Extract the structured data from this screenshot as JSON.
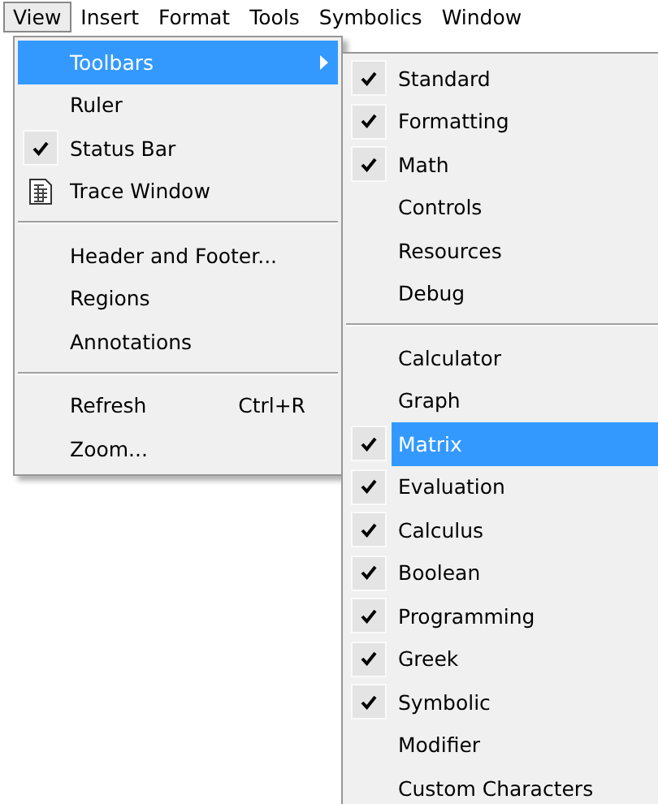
{
  "menu_bar": [
    {
      "label": "View",
      "selected": true
    },
    {
      "label": "Insert",
      "selected": false
    },
    {
      "label": "Format",
      "selected": false
    },
    {
      "label": "Tools",
      "selected": false
    },
    {
      "label": "Symbolics",
      "selected": false
    },
    {
      "label": "Window",
      "selected": false
    }
  ],
  "view_menu": [
    {
      "kind": "item",
      "label": "Toolbars",
      "checked": false,
      "selected": true,
      "has_submenu": true
    },
    {
      "kind": "item",
      "label": "Ruler",
      "checked": false,
      "selected": false,
      "has_submenu": false
    },
    {
      "kind": "item",
      "label": "Status Bar",
      "checked": true,
      "selected": false,
      "has_submenu": false
    },
    {
      "kind": "icon_item",
      "label": "Trace Window",
      "checked": false,
      "selected": false,
      "has_submenu": false
    },
    {
      "kind": "separator"
    },
    {
      "kind": "item",
      "label": "Header and Footer...",
      "checked": false,
      "selected": false,
      "has_submenu": false
    },
    {
      "kind": "item",
      "label": "Regions",
      "checked": false,
      "selected": false,
      "has_submenu": false
    },
    {
      "kind": "item",
      "label": "Annotations",
      "checked": false,
      "selected": false,
      "has_submenu": false
    },
    {
      "kind": "separator"
    },
    {
      "kind": "item",
      "label": "Refresh",
      "shortcut": "Ctrl+R",
      "checked": false,
      "selected": false,
      "has_submenu": false
    },
    {
      "kind": "item",
      "label": "Zoom...",
      "checked": false,
      "selected": false,
      "has_submenu": false
    }
  ],
  "toolbars_submenu": [
    {
      "kind": "item",
      "label": "Standard",
      "checked": true,
      "selected": false
    },
    {
      "kind": "item",
      "label": "Formatting",
      "checked": true,
      "selected": false
    },
    {
      "kind": "item",
      "label": "Math",
      "checked": true,
      "selected": false
    },
    {
      "kind": "item",
      "label": "Controls",
      "checked": false,
      "selected": false
    },
    {
      "kind": "item",
      "label": "Resources",
      "checked": false,
      "selected": false
    },
    {
      "kind": "item",
      "label": "Debug",
      "checked": false,
      "selected": false
    },
    {
      "kind": "separator"
    },
    {
      "kind": "item",
      "label": "Calculator",
      "checked": false,
      "selected": false
    },
    {
      "kind": "item",
      "label": "Graph",
      "checked": false,
      "selected": false
    },
    {
      "kind": "item",
      "label": "Matrix",
      "checked": true,
      "selected": true
    },
    {
      "kind": "item",
      "label": "Evaluation",
      "checked": true,
      "selected": false
    },
    {
      "kind": "item",
      "label": "Calculus",
      "checked": true,
      "selected": false
    },
    {
      "kind": "item",
      "label": "Boolean",
      "checked": true,
      "selected": false
    },
    {
      "kind": "item",
      "label": "Programming",
      "checked": true,
      "selected": false
    },
    {
      "kind": "item",
      "label": "Greek",
      "checked": true,
      "selected": false
    },
    {
      "kind": "item",
      "label": "Symbolic",
      "checked": true,
      "selected": false
    },
    {
      "kind": "item",
      "label": "Modifier",
      "checked": false,
      "selected": false
    },
    {
      "kind": "item",
      "label": "Custom Characters",
      "checked": false,
      "selected": false
    }
  ]
}
